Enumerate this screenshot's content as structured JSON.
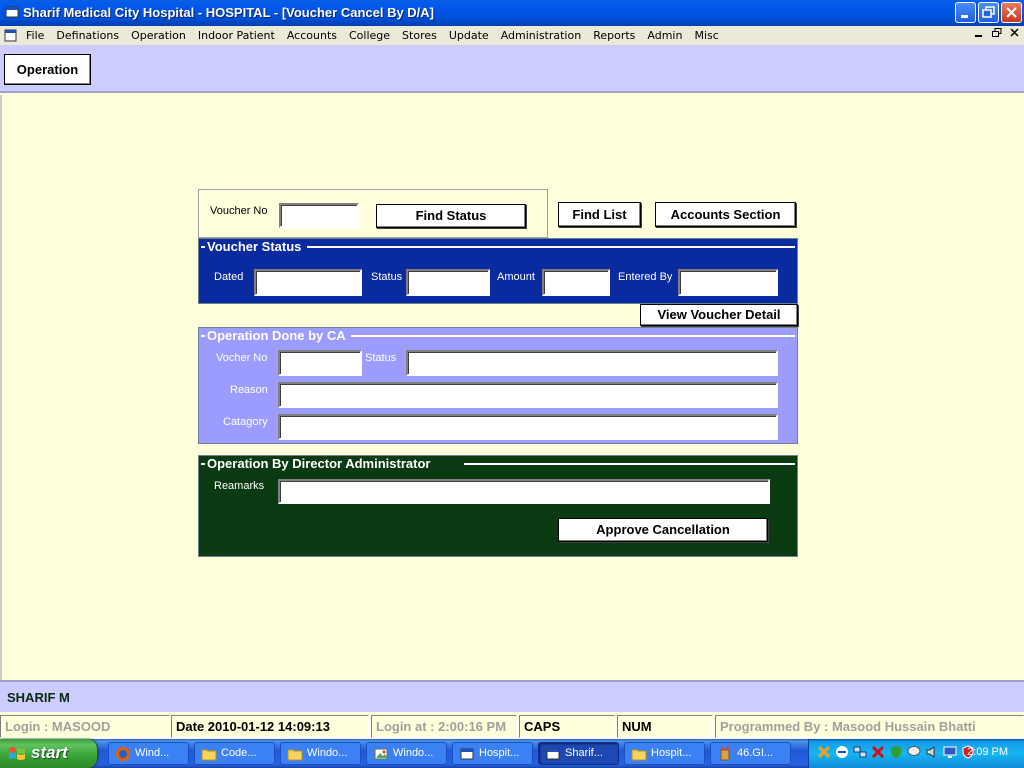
{
  "window": {
    "title": "Sharif Medical City Hospital - HOSPITAL - [Voucher Cancel By D/A]"
  },
  "menu": {
    "items": [
      "File",
      "Definations",
      "Operation",
      "Indoor Patient",
      "Accounts",
      "College",
      "Stores",
      "Update",
      "Administration",
      "Reports",
      "Admin",
      "Misc"
    ]
  },
  "toolbar": {
    "operation_label": "Operation"
  },
  "search": {
    "voucher_no_label": "Voucher No",
    "voucher_no_value": "",
    "find_status_label": "Find Status",
    "find_list_label": "Find List",
    "accounts_section_label": "Accounts Section"
  },
  "voucher_status": {
    "title": "Voucher Status",
    "dated_label": "Dated",
    "status_label": "Status",
    "amount_label": "Amount",
    "entered_by_label": "Entered By",
    "dated_value": "",
    "status_value": "",
    "amount_value": "",
    "entered_by_value": "",
    "view_detail_label": "View Voucher Detail"
  },
  "ca_panel": {
    "title": "Operation Done by CA",
    "voucher_no_label": "Vocher No",
    "status_label": "Status",
    "reason_label": "Reason",
    "category_label": "Catagory",
    "voucher_no_value": "",
    "status_value": "",
    "reason_value": "",
    "category_value": ""
  },
  "director_panel": {
    "title": "Operation By Director Administrator",
    "remarks_label": "Reamarks",
    "remarks_value": "",
    "approve_label": "Approve Cancellation"
  },
  "user_bar": {
    "name": "SHARIF M"
  },
  "status_bar": {
    "login": "Login :  MASOOD",
    "date": "Date 2010-01-12 14:09:13",
    "login_at": "Login at : 2:00:16 PM",
    "caps": "CAPS",
    "num": "NUM",
    "programmer": "Programmed By : Masood Hussain Bhatti"
  },
  "taskbar": {
    "start_label": "start",
    "tasks": [
      {
        "label": "Wind...",
        "icon": "firefox-icon"
      },
      {
        "label": "Code...",
        "icon": "folder-icon"
      },
      {
        "label": "Windo...",
        "icon": "folder-icon"
      },
      {
        "label": "Windo...",
        "icon": "image-viewer-icon"
      },
      {
        "label": "Hospit...",
        "icon": "app-icon"
      },
      {
        "label": "Sharif...",
        "icon": "app-icon"
      },
      {
        "label": "Hospit...",
        "icon": "folder-icon"
      },
      {
        "label": "46.GI...",
        "icon": "paint-icon"
      }
    ],
    "clock": "2:09 PM"
  },
  "colors": {
    "workarea_bg": "#ffffdc",
    "toolbar_bg": "#ccccff",
    "voucher_panel_bg": "#0a2aa0",
    "ca_panel_bg": "#9c9cff",
    "director_panel_bg": "#0a3a12"
  }
}
